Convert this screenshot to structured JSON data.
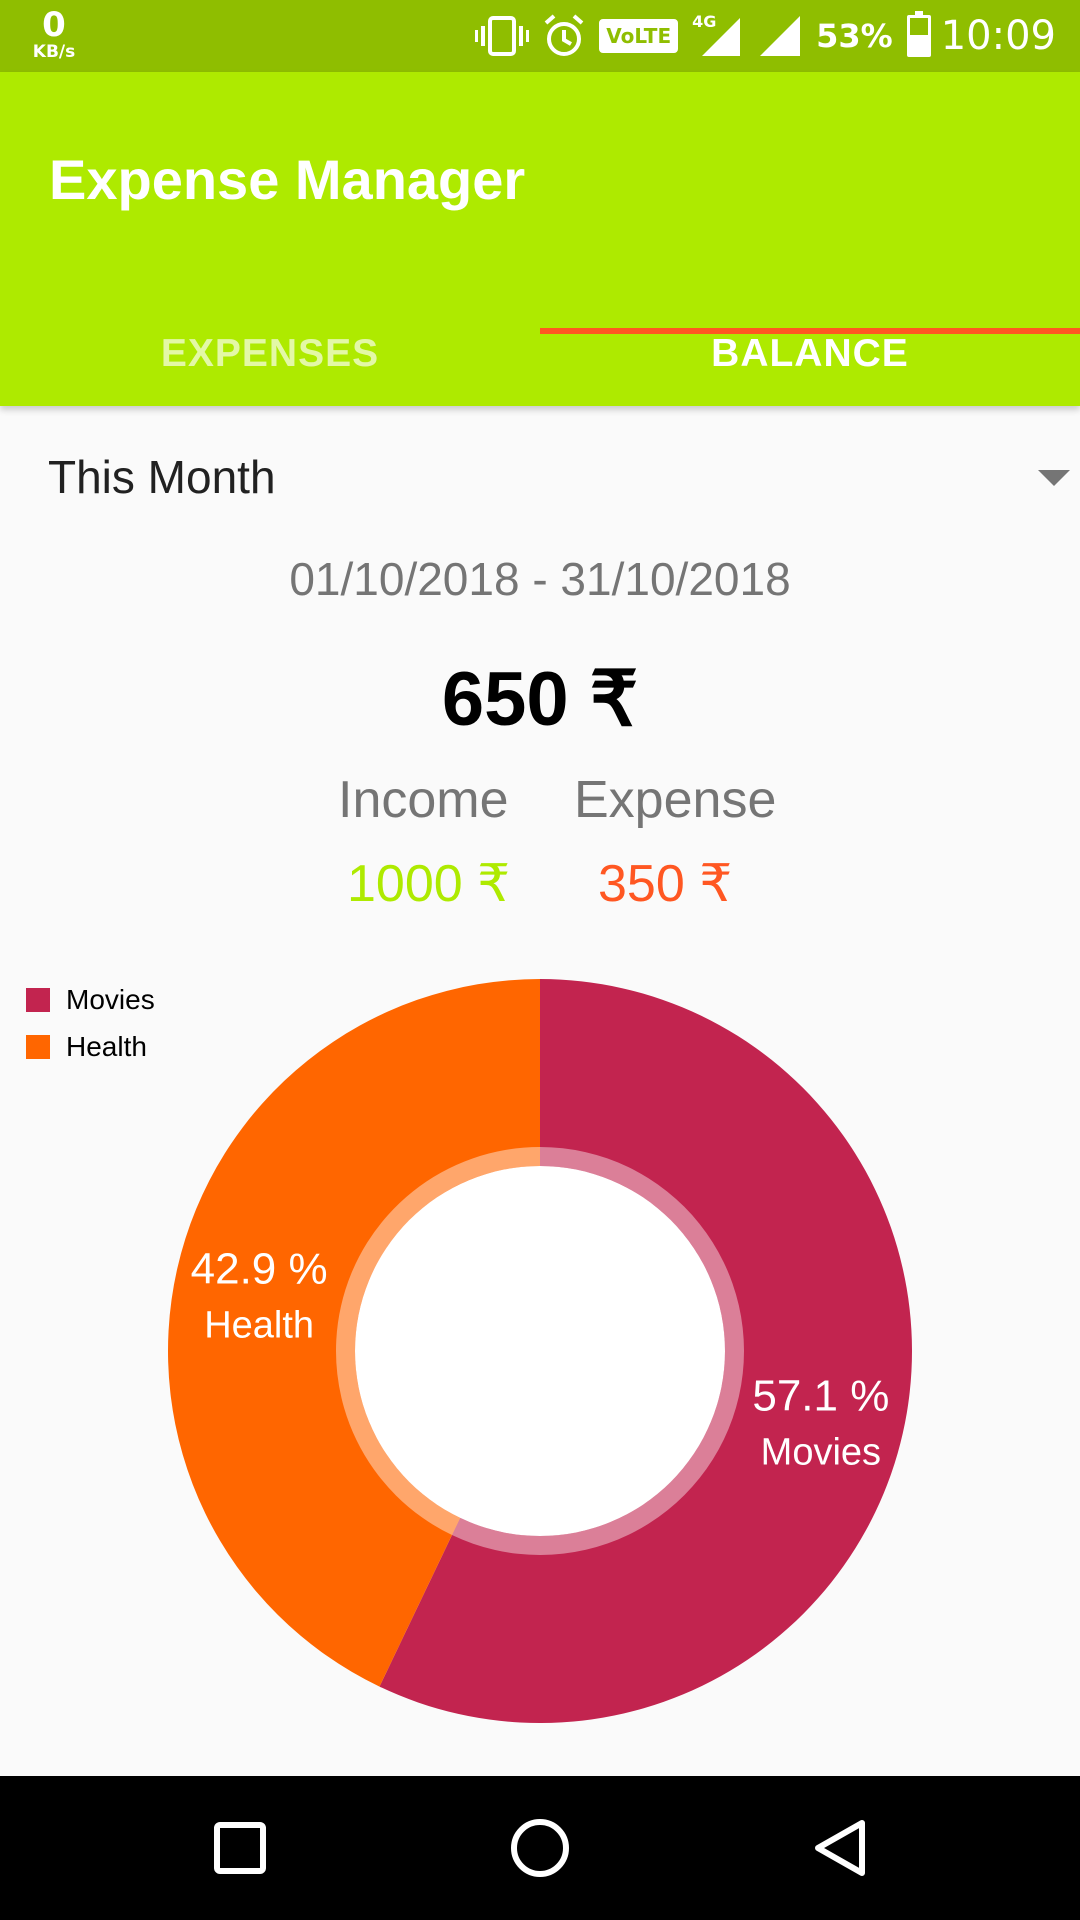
{
  "status_bar": {
    "speed_value": "0",
    "speed_unit": "KB/s",
    "volte_label": "VoLTE",
    "network_label": "4G",
    "battery_percent": "53%",
    "battery_level": 0.53,
    "time": "10:09"
  },
  "app": {
    "title": "Expense Manager"
  },
  "tabs": [
    {
      "label": "EXPENSES",
      "selected": false
    },
    {
      "label": "BALANCE",
      "selected": true
    }
  ],
  "colors": {
    "primary": "#aeea00",
    "status_bar": "#8fbe00",
    "accent": "#ff5722",
    "movies": "#c2244f",
    "health": "#ff6600"
  },
  "period": {
    "selected": "This Month",
    "date_range": "01/10/2018 - 31/10/2018"
  },
  "balance": {
    "total": "650 ₹",
    "income_label": "Income",
    "income_value": "1000 ₹",
    "expense_label": "Expense",
    "expense_value": "350 ₹"
  },
  "chart_data": {
    "type": "pie",
    "categories": [
      "Movies",
      "Health"
    ],
    "values": [
      57.1,
      42.9
    ],
    "percent_labels": [
      "57.1 %",
      "42.9 %"
    ],
    "colors": [
      "#c2244f",
      "#ff6600"
    ],
    "legend_position": "top-left",
    "hole": true
  },
  "nav": {
    "buttons": [
      "recents",
      "home",
      "back"
    ]
  }
}
